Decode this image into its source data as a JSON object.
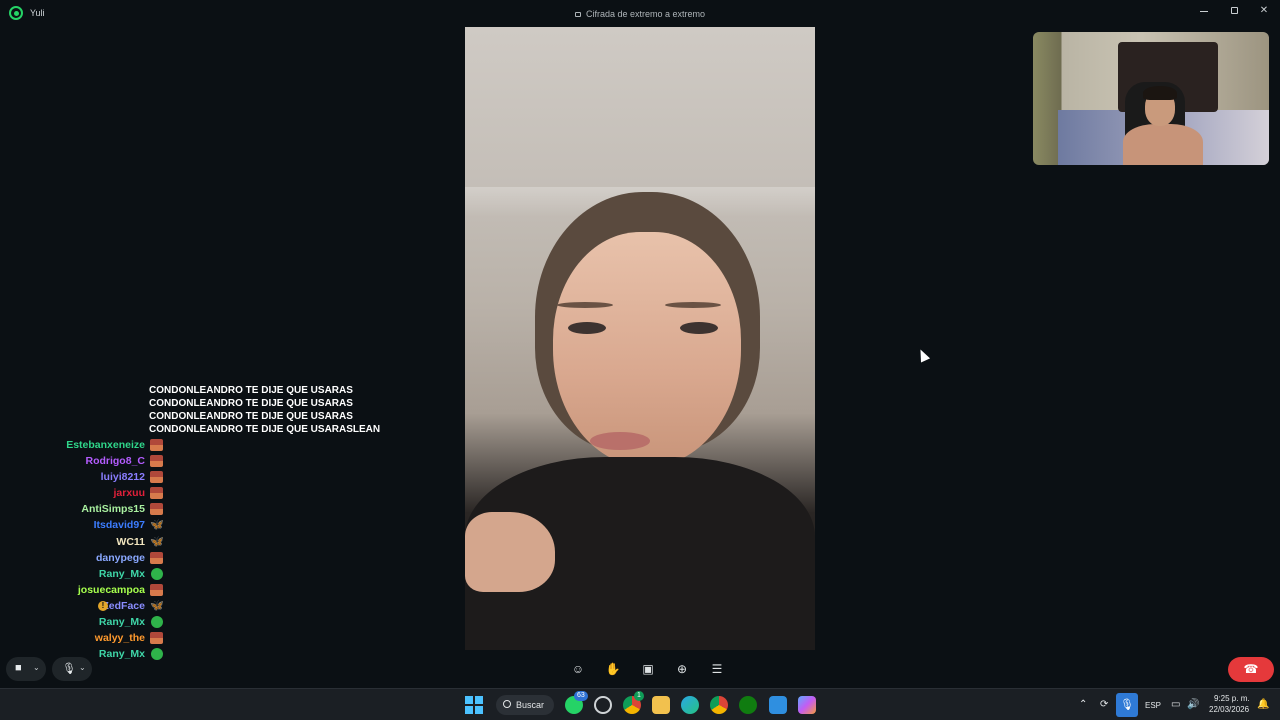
{
  "window": {
    "contact_name": "Yuli",
    "encryption_text": "Cifrada de extremo a extremo",
    "accent_color": "#25d366"
  },
  "chat_overlay": {
    "spam_lines": [
      "CONDONLEANDRO TE DIJE QUE USARAS",
      "CONDONLEANDRO TE DIJE QUE USARAS",
      "CONDONLEANDRO TE DIJE QUE USARAS",
      "CONDONLEANDRO TE DIJE QUE USARASLEAN"
    ],
    "users": [
      {
        "name": "Estebanxeneize",
        "color": "#2fd68a",
        "badge": "flag"
      },
      {
        "name": "Rodrigo8_C",
        "color": "#b45cff",
        "badge": "flag"
      },
      {
        "name": "luiyi8212",
        "color": "#8a7dff",
        "badge": "flag"
      },
      {
        "name": "jarxuu",
        "color": "#e0203a",
        "badge": "flag"
      },
      {
        "name": "AntiSimps15",
        "color": "#a9f0a0",
        "badge": "flag"
      },
      {
        "name": "Itsdavid97",
        "color": "#3c7dff",
        "badge": "butterfly"
      },
      {
        "name": "WC11",
        "color": "#f2e6c0",
        "badge": "butterfly"
      },
      {
        "name": "danypege",
        "color": "#8aa8ff",
        "badge": "flag"
      },
      {
        "name": "Rany_Mx",
        "color": "#3fd6a8",
        "badge": "smile"
      },
      {
        "name": "josuecampoa",
        "color": "#a6ff4d",
        "badge": "flag"
      },
      {
        "name": "ZedFace",
        "color": "#8a8dff",
        "badge": "butterfly",
        "warn": "!"
      },
      {
        "name": "Rany_Mx",
        "color": "#3fd6a8",
        "badge": "smile"
      },
      {
        "name": "walyy_the",
        "color": "#ff9a2e",
        "badge": "flag"
      },
      {
        "name": "Rany_Mx",
        "color": "#3fd6a8",
        "badge": "smile"
      }
    ]
  },
  "call_controls": {
    "left": [
      {
        "name": "camera",
        "icon": "video-camera-icon"
      },
      {
        "name": "microphone",
        "icon": "microphone-icon"
      }
    ],
    "center": [
      {
        "name": "react",
        "icon": "emoji-icon",
        "glyph": "☺"
      },
      {
        "name": "raise-hand",
        "icon": "hand-icon",
        "glyph": "✋"
      },
      {
        "name": "share-screen",
        "icon": "share-screen-icon",
        "glyph": "▣"
      },
      {
        "name": "add-participant",
        "icon": "add-person-icon",
        "glyph": "⊕"
      },
      {
        "name": "more",
        "icon": "more-icon",
        "glyph": "☰"
      }
    ],
    "end_call_color": "#e5393b"
  },
  "taskbar": {
    "search_label": "Buscar",
    "whatsapp_badge": "63",
    "chrome_badge": "1",
    "language": "ESP",
    "time": "9:25 p. m.",
    "date": "22/03/2026"
  }
}
